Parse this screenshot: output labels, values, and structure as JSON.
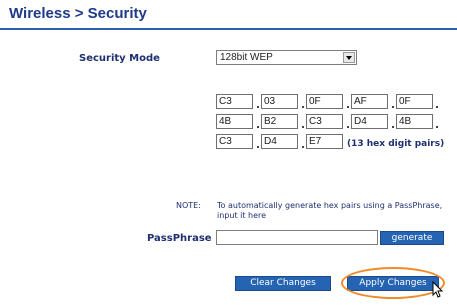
{
  "header": {
    "title": "Wireless > Security"
  },
  "security_mode": {
    "label": "Security Mode",
    "selected": "128bit WEP"
  },
  "hex_keys": {
    "row1": [
      "C3",
      "03",
      "0F",
      "AF",
      "0F"
    ],
    "row2": [
      "4B",
      "B2",
      "C3",
      "D4",
      "4B"
    ],
    "row3": [
      "C3",
      "D4",
      "E7"
    ],
    "hint": "(13 hex digit pairs)"
  },
  "note": {
    "label": "NOTE:",
    "text": "To automatically generate hex pairs using a PassPhrase, input it here"
  },
  "passphrase": {
    "label": "PassPhrase",
    "value": "",
    "generate_label": "generate"
  },
  "actions": {
    "clear_label": "Clear Changes",
    "apply_label": "Apply Changes"
  },
  "colors": {
    "accent": "#2563b3",
    "highlight": "#f08a2a",
    "text": "#1f2f70"
  }
}
